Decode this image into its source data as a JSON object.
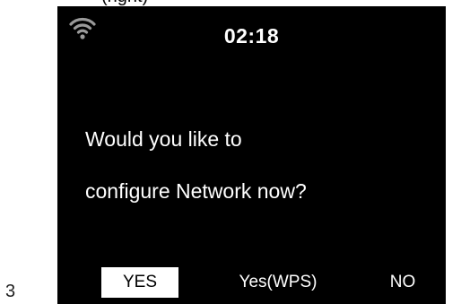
{
  "caption_fragment": "(right)",
  "page_number": "3",
  "status_bar": {
    "icon": "wifi-icon",
    "time": "02:18"
  },
  "dialog": {
    "line1": "Would you like to",
    "line2": "configure Network now?"
  },
  "options": [
    {
      "label": "YES",
      "selected": true
    },
    {
      "label": "Yes(WPS)",
      "selected": false
    },
    {
      "label": "NO",
      "selected": false
    }
  ],
  "colors": {
    "screen_background": "#000000",
    "text": "#ffffff",
    "selection_background": "#ffffff",
    "selection_text": "#000000"
  }
}
